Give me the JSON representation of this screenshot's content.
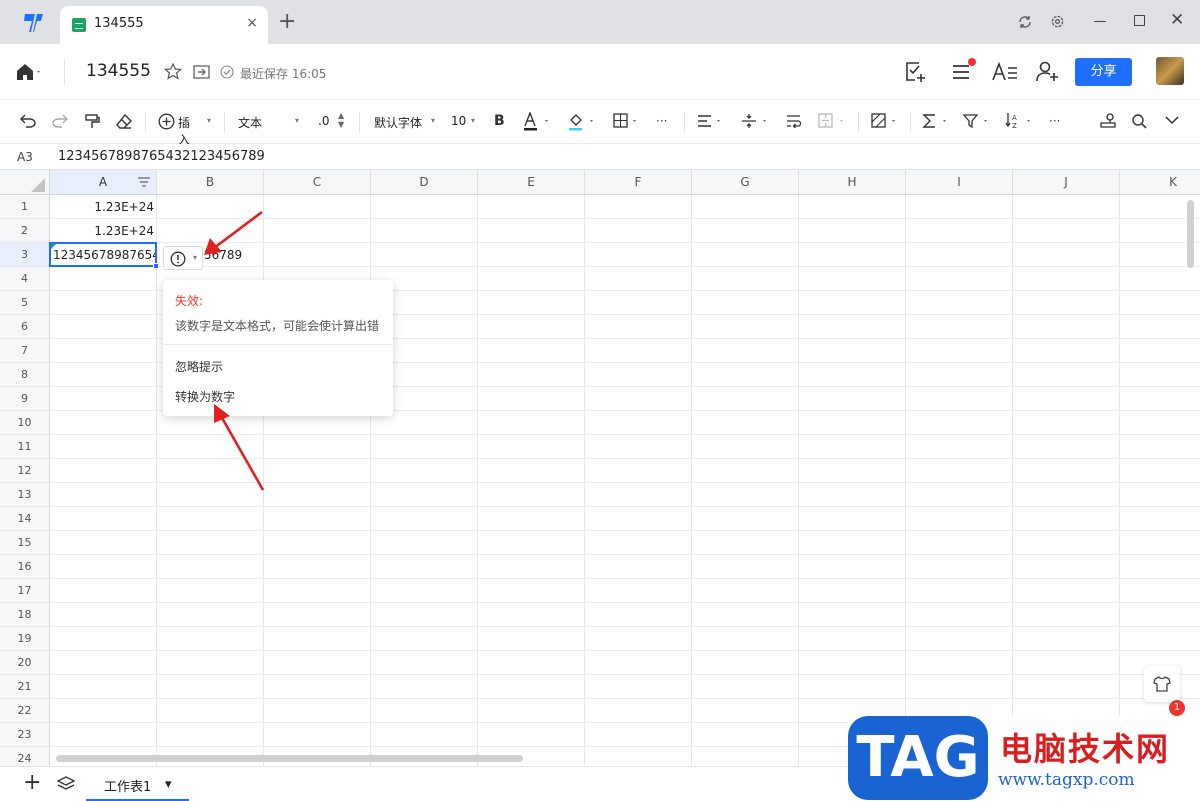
{
  "browser": {
    "tab_title": "134555",
    "new_tab_label": "+",
    "close_tab_label": "×"
  },
  "header": {
    "doc_name": "134555",
    "save_status": "最近保存 16:05",
    "share_label": "分享"
  },
  "toolbar": {
    "insert_label": "插入",
    "format_label": "文本",
    "decimal_label": ".0",
    "font_label": "默认字体",
    "size_label": "10",
    "bold_label": "B",
    "more_label": "···"
  },
  "formula_bar": {
    "cell_ref": "A3",
    "formula": "1234567898765432123456789"
  },
  "grid": {
    "columns": [
      "A",
      "B",
      "C",
      "D",
      "E",
      "F",
      "G",
      "H",
      "I",
      "J",
      "K"
    ],
    "rows": [
      "1",
      "2",
      "3",
      "4",
      "5",
      "6",
      "7",
      "8",
      "9",
      "10",
      "11",
      "12",
      "13",
      "14",
      "15",
      "16",
      "17",
      "18",
      "19",
      "20",
      "21",
      "22",
      "23",
      "24"
    ],
    "cells": {
      "A1": "1.23E+24",
      "A2": "1.23E+24",
      "A3": "12345678987654",
      "B3": "56789"
    }
  },
  "error_popup": {
    "title": "失效:",
    "description": "该数字是文本格式，可能会使计算出错",
    "ignore_label": "忽略提示",
    "convert_label": "转换为数字"
  },
  "sheets": {
    "active": "工作表1"
  },
  "notification_count": "1",
  "watermark": {
    "tag": "TAG",
    "cn": "电脑技术网",
    "url": "www.tagxp.com"
  },
  "colors": {
    "accent": "#1f6fff",
    "error": "#e53935",
    "arrow": "#e02020"
  }
}
